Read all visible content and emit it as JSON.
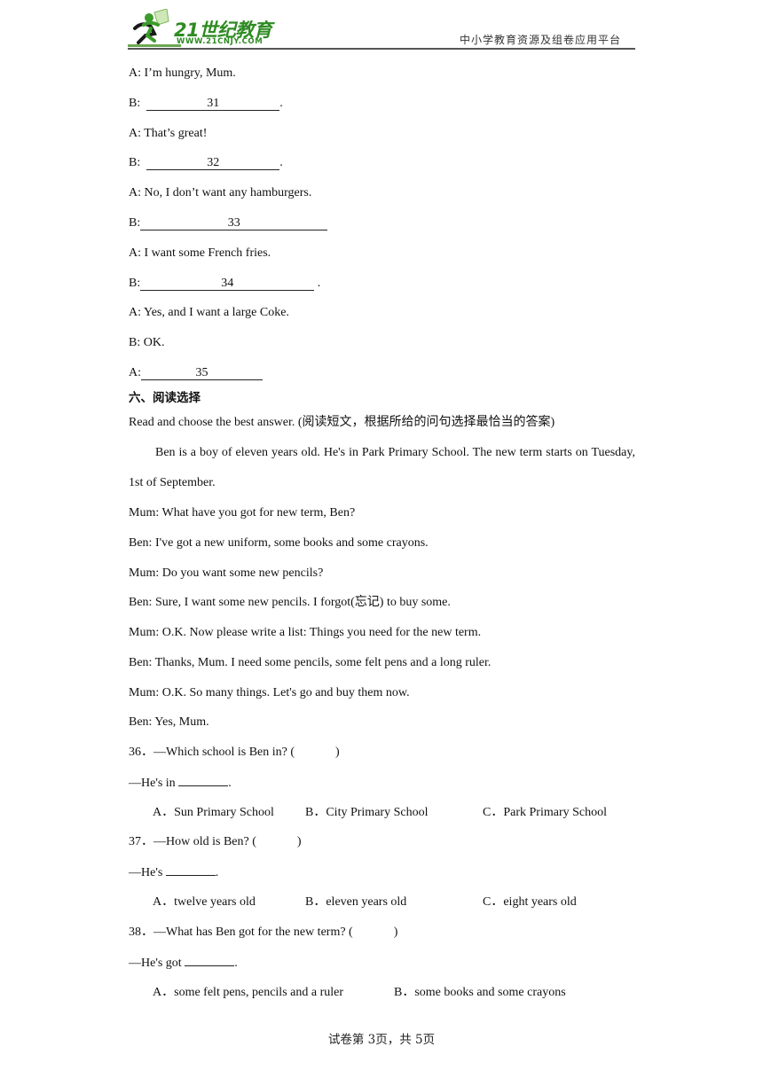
{
  "header": {
    "logo_title": "21世纪教育",
    "logo_url": "WWW.21CNJY.COM",
    "platform": "中小学教育资源及组卷应用平台",
    "brand_color": "#2e8b22"
  },
  "dialogue": [
    {
      "speaker": "A:",
      "text": " I’m hungry, Mum."
    },
    {
      "speaker": "B:",
      "blank": "31",
      "suffix": "."
    },
    {
      "speaker": "A:",
      "text": " That’s great!"
    },
    {
      "speaker": "B:",
      "blank": "32",
      "suffix": "."
    },
    {
      "speaker": "A:",
      "text": " No, I don’t want any hamburgers."
    },
    {
      "speaker": "B:",
      "blank": "33",
      "suffix": ""
    },
    {
      "speaker": "A:",
      "text": " I want some French fries."
    },
    {
      "speaker": "B:",
      "blank": "34",
      "suffix": " ."
    },
    {
      "speaker": "A:",
      "text": " Yes, and I want a large Coke."
    },
    {
      "speaker": "B:",
      "text": " OK."
    },
    {
      "speaker": "A:",
      "blank": "35",
      "suffix": ""
    }
  ],
  "section": {
    "title": "六、阅读选择",
    "instruction": "Read and choose the best answer. (阅读短文，根据所给的问句选择最恰当的答案)",
    "passage": "Ben is a boy of eleven years old. He's in Park Primary School. The new term starts on Tuesday, 1st of September.",
    "conversation": [
      "Mum: What have you got for new term, Ben?",
      "Ben: I've got a new uniform, some books and some crayons.",
      "Mum: Do you want some new pencils?",
      "Ben: Sure, I want some new pencils. I forgot(忘记) to buy some.",
      "Mum: O.K. Now please write a list: Things you need for the new term.",
      "Ben: Thanks, Mum. I need some pencils, some felt pens and a long ruler.",
      "Mum: O.K. So many things. Let's go and buy them now.",
      "Ben: Yes, Mum."
    ]
  },
  "questions": [
    {
      "number": "36．",
      "question": "—Which school is Ben in? (",
      "close": ")",
      "answer_prefix": "—He's in ",
      "answer_suffix": ".",
      "options": [
        {
          "label": "A．",
          "text": "Sun Primary School"
        },
        {
          "label": "B．",
          "text": "City Primary School"
        },
        {
          "label": "C．",
          "text": "Park Primary School"
        }
      ]
    },
    {
      "number": "37．",
      "question": "—How old is Ben? (",
      "close": ")",
      "answer_prefix": "—He's ",
      "answer_suffix": ".",
      "options": [
        {
          "label": "A．",
          "text": "twelve years old"
        },
        {
          "label": "B．",
          "text": "eleven years old"
        },
        {
          "label": "C．",
          "text": "eight years old"
        }
      ]
    },
    {
      "number": "38．",
      "question": "—What has Ben got for the new term? (",
      "close": ")",
      "answer_prefix": "—He's got ",
      "answer_suffix": ".",
      "options": [
        {
          "label": "A．",
          "text": "some felt pens, pencils and a ruler"
        },
        {
          "label": "B．",
          "text": "some books and some crayons"
        }
      ]
    }
  ],
  "footer": {
    "page_info": "试卷第 3页，共 5页"
  }
}
